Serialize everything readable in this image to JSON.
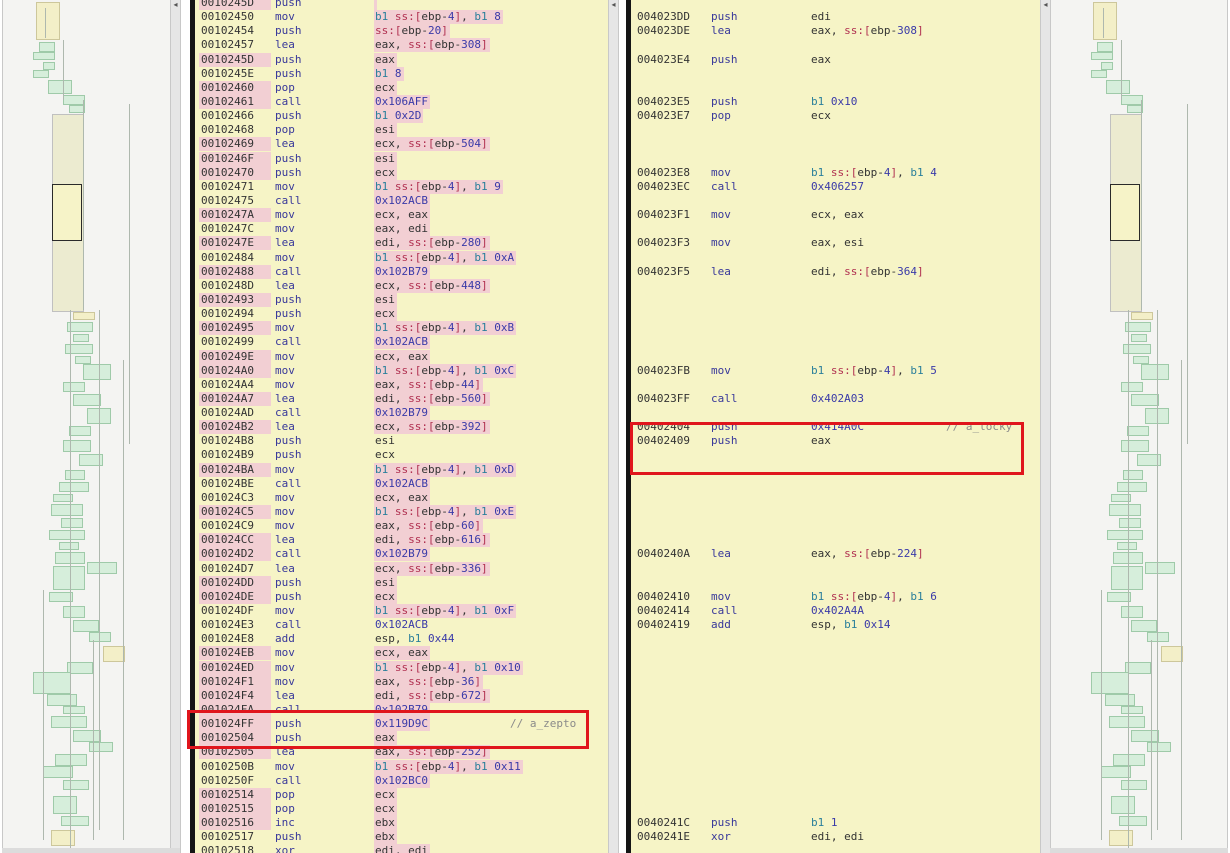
{
  "left_listing": [
    {
      "addr": "0010245D",
      "mnemonic": "push",
      "operand": "",
      "hl_addr": true,
      "hl_op": true
    },
    {
      "addr": "00102450",
      "mnemonic": "mov",
      "operand": "b1 ss:[ebp-4], b1 8",
      "hl_addr": false,
      "hl_op": true
    },
    {
      "addr": "00102454",
      "mnemonic": "push",
      "operand": "ss:[ebp-20]",
      "hl_addr": false,
      "hl_op": true
    },
    {
      "addr": "00102457",
      "mnemonic": "lea",
      "operand": "eax, ss:[ebp-308]",
      "hl_addr": false,
      "hl_op": true
    },
    {
      "addr": "0010245D",
      "mnemonic": "push",
      "operand": "eax",
      "hl_addr": true,
      "hl_op": true
    },
    {
      "addr": "0010245E",
      "mnemonic": "push",
      "operand": "b1 8",
      "hl_addr": false,
      "hl_op": true
    },
    {
      "addr": "00102460",
      "mnemonic": "pop",
      "operand": "ecx",
      "hl_addr": true,
      "hl_op": true
    },
    {
      "addr": "00102461",
      "mnemonic": "call",
      "operand": "0x106AFF",
      "hl_addr": true,
      "hl_op": true
    },
    {
      "addr": "00102466",
      "mnemonic": "push",
      "operand": "b1 0x2D",
      "hl_addr": false,
      "hl_op": true
    },
    {
      "addr": "00102468",
      "mnemonic": "pop",
      "operand": "esi",
      "hl_addr": false,
      "hl_op": true
    },
    {
      "addr": "00102469",
      "mnemonic": "lea",
      "operand": "ecx, ss:[ebp-504]",
      "hl_addr": true,
      "hl_op": true
    },
    {
      "addr": "0010246F",
      "mnemonic": "push",
      "operand": "esi",
      "hl_addr": true,
      "hl_op": true
    },
    {
      "addr": "00102470",
      "mnemonic": "push",
      "operand": "ecx",
      "hl_addr": true,
      "hl_op": true
    },
    {
      "addr": "00102471",
      "mnemonic": "mov",
      "operand": "b1 ss:[ebp-4], b1 9",
      "hl_addr": false,
      "hl_op": true
    },
    {
      "addr": "00102475",
      "mnemonic": "call",
      "operand": "0x102ACB",
      "hl_addr": false,
      "hl_op": true
    },
    {
      "addr": "0010247A",
      "mnemonic": "mov",
      "operand": "ecx, eax",
      "hl_addr": true,
      "hl_op": true
    },
    {
      "addr": "0010247C",
      "mnemonic": "mov",
      "operand": "eax, edi",
      "hl_addr": false,
      "hl_op": true
    },
    {
      "addr": "0010247E",
      "mnemonic": "lea",
      "operand": "edi, ss:[ebp-280]",
      "hl_addr": true,
      "hl_op": true
    },
    {
      "addr": "00102484",
      "mnemonic": "mov",
      "operand": "b1 ss:[ebp-4], b1 0xA",
      "hl_addr": false,
      "hl_op": true
    },
    {
      "addr": "00102488",
      "mnemonic": "call",
      "operand": "0x102B79",
      "hl_addr": true,
      "hl_op": true
    },
    {
      "addr": "0010248D",
      "mnemonic": "lea",
      "operand": "ecx, ss:[ebp-448]",
      "hl_addr": false,
      "hl_op": true
    },
    {
      "addr": "00102493",
      "mnemonic": "push",
      "operand": "esi",
      "hl_addr": true,
      "hl_op": true
    },
    {
      "addr": "00102494",
      "mnemonic": "push",
      "operand": "ecx",
      "hl_addr": false,
      "hl_op": true
    },
    {
      "addr": "00102495",
      "mnemonic": "mov",
      "operand": "b1 ss:[ebp-4], b1 0xB",
      "hl_addr": true,
      "hl_op": true
    },
    {
      "addr": "00102499",
      "mnemonic": "call",
      "operand": "0x102ACB",
      "hl_addr": false,
      "hl_op": true
    },
    {
      "addr": "0010249E",
      "mnemonic": "mov",
      "operand": "ecx, eax",
      "hl_addr": true,
      "hl_op": true
    },
    {
      "addr": "001024A0",
      "mnemonic": "mov",
      "operand": "b1 ss:[ebp-4], b1 0xC",
      "hl_addr": true,
      "hl_op": true
    },
    {
      "addr": "001024A4",
      "mnemonic": "mov",
      "operand": "eax, ss:[ebp-44]",
      "hl_addr": false,
      "hl_op": true
    },
    {
      "addr": "001024A7",
      "mnemonic": "lea",
      "operand": "edi, ss:[ebp-560]",
      "hl_addr": true,
      "hl_op": true
    },
    {
      "addr": "001024AD",
      "mnemonic": "call",
      "operand": "0x102B79",
      "hl_addr": false,
      "hl_op": true
    },
    {
      "addr": "001024B2",
      "mnemonic": "lea",
      "operand": "ecx, ss:[ebp-392]",
      "hl_addr": true,
      "hl_op": true
    },
    {
      "addr": "001024B8",
      "mnemonic": "push",
      "operand": "esi",
      "hl_addr": false,
      "hl_op": false
    },
    {
      "addr": "001024B9",
      "mnemonic": "push",
      "operand": "ecx",
      "hl_addr": false,
      "hl_op": false
    },
    {
      "addr": "001024BA",
      "mnemonic": "mov",
      "operand": "b1 ss:[ebp-4], b1 0xD",
      "hl_addr": true,
      "hl_op": true
    },
    {
      "addr": "001024BE",
      "mnemonic": "call",
      "operand": "0x102ACB",
      "hl_addr": false,
      "hl_op": true
    },
    {
      "addr": "001024C3",
      "mnemonic": "mov",
      "operand": "ecx, eax",
      "hl_addr": false,
      "hl_op": true
    },
    {
      "addr": "001024C5",
      "mnemonic": "mov",
      "operand": "b1 ss:[ebp-4], b1 0xE",
      "hl_addr": true,
      "hl_op": true
    },
    {
      "addr": "001024C9",
      "mnemonic": "mov",
      "operand": "eax, ss:[ebp-60]",
      "hl_addr": false,
      "hl_op": true
    },
    {
      "addr": "001024CC",
      "mnemonic": "lea",
      "operand": "edi, ss:[ebp-616]",
      "hl_addr": true,
      "hl_op": true
    },
    {
      "addr": "001024D2",
      "mnemonic": "call",
      "operand": "0x102B79",
      "hl_addr": true,
      "hl_op": true
    },
    {
      "addr": "001024D7",
      "mnemonic": "lea",
      "operand": "ecx, ss:[ebp-336]",
      "hl_addr": false,
      "hl_op": true
    },
    {
      "addr": "001024DD",
      "mnemonic": "push",
      "operand": "esi",
      "hl_addr": true,
      "hl_op": true
    },
    {
      "addr": "001024DE",
      "mnemonic": "push",
      "operand": "ecx",
      "hl_addr": true,
      "hl_op": true
    },
    {
      "addr": "001024DF",
      "mnemonic": "mov",
      "operand": "b1 ss:[ebp-4], b1 0xF",
      "hl_addr": false,
      "hl_op": true
    },
    {
      "addr": "001024E3",
      "mnemonic": "call",
      "operand": "0x102ACB",
      "hl_addr": false,
      "hl_op": false
    },
    {
      "addr": "001024E8",
      "mnemonic": "add",
      "operand": "esp, b1 0x44",
      "hl_addr": false,
      "hl_op": false
    },
    {
      "addr": "001024EB",
      "mnemonic": "mov",
      "operand": "ecx, eax",
      "hl_addr": true,
      "hl_op": true
    },
    {
      "addr": "001024ED",
      "mnemonic": "mov",
      "operand": "b1 ss:[ebp-4], b1 0x10",
      "hl_addr": true,
      "hl_op": true
    },
    {
      "addr": "001024F1",
      "mnemonic": "mov",
      "operand": "eax, ss:[ebp-36]",
      "hl_addr": true,
      "hl_op": true
    },
    {
      "addr": "001024F4",
      "mnemonic": "lea",
      "operand": "edi, ss:[ebp-672]",
      "hl_addr": true,
      "hl_op": true
    },
    {
      "addr": "001024FA",
      "mnemonic": "call",
      "operand": "0x102B79",
      "hl_addr": true,
      "hl_op": true
    },
    {
      "addr": "001024FF",
      "mnemonic": "push",
      "operand": "0x119D9C",
      "comment": "// a_zepto",
      "hl_addr": true,
      "hl_op": true
    },
    {
      "addr": "00102504",
      "mnemonic": "push",
      "operand": "eax",
      "hl_addr": true,
      "hl_op": true
    },
    {
      "addr": "00102505",
      "mnemonic": "lea",
      "operand": "eax, ss:[ebp-252]",
      "hl_addr": true,
      "hl_op": true
    },
    {
      "addr": "0010250B",
      "mnemonic": "mov",
      "operand": "b1 ss:[ebp-4], b1 0x11",
      "hl_addr": false,
      "hl_op": true
    },
    {
      "addr": "0010250F",
      "mnemonic": "call",
      "operand": "0x102BC0",
      "hl_addr": false,
      "hl_op": true
    },
    {
      "addr": "00102514",
      "mnemonic": "pop",
      "operand": "ecx",
      "hl_addr": true,
      "hl_op": true
    },
    {
      "addr": "00102515",
      "mnemonic": "pop",
      "operand": "ecx",
      "hl_addr": true,
      "hl_op": true
    },
    {
      "addr": "00102516",
      "mnemonic": "inc",
      "operand": "ebx",
      "hl_addr": true,
      "hl_op": true
    },
    {
      "addr": "00102517",
      "mnemonic": "push",
      "operand": "ebx",
      "hl_addr": false,
      "hl_op": true
    },
    {
      "addr": "00102518",
      "mnemonic": "xor",
      "operand": "edi, edi",
      "hl_addr": false,
      "hl_op": true
    }
  ],
  "right_listing": [
    {
      "row": 1,
      "addr": "004023DD",
      "mnemonic": "push",
      "operand": "edi"
    },
    {
      "row": 2,
      "addr": "004023DE",
      "mnemonic": "lea",
      "operand": "eax, ss:[ebp-308]"
    },
    {
      "row": 4,
      "addr": "004023E4",
      "mnemonic": "push",
      "operand": "eax"
    },
    {
      "row": 7,
      "addr": "004023E5",
      "mnemonic": "push",
      "operand": "b1 0x10"
    },
    {
      "row": 8,
      "addr": "004023E7",
      "mnemonic": "pop",
      "operand": "ecx"
    },
    {
      "row": 12,
      "addr": "004023E8",
      "mnemonic": "mov",
      "operand": "b1 ss:[ebp-4], b1 4"
    },
    {
      "row": 13,
      "addr": "004023EC",
      "mnemonic": "call",
      "operand": "0x406257"
    },
    {
      "row": 15,
      "addr": "004023F1",
      "mnemonic": "mov",
      "operand": "ecx, eax"
    },
    {
      "row": 17,
      "addr": "004023F3",
      "mnemonic": "mov",
      "operand": "eax, esi"
    },
    {
      "row": 19,
      "addr": "004023F5",
      "mnemonic": "lea",
      "operand": "edi, ss:[ebp-364]"
    },
    {
      "row": 26,
      "addr": "004023FB",
      "mnemonic": "mov",
      "operand": "b1 ss:[ebp-4], b1 5"
    },
    {
      "row": 28,
      "addr": "004023FF",
      "mnemonic": "call",
      "operand": "0x402A03"
    },
    {
      "row": 30,
      "addr": "00402404",
      "mnemonic": "push",
      "operand": "0x414A0C",
      "comment": "// a_locky"
    },
    {
      "row": 31,
      "addr": "00402409",
      "mnemonic": "push",
      "operand": "eax"
    },
    {
      "row": 39,
      "addr": "0040240A",
      "mnemonic": "lea",
      "operand": "eax, ss:[ebp-224]"
    },
    {
      "row": 42,
      "addr": "00402410",
      "mnemonic": "mov",
      "operand": "b1 ss:[ebp-4], b1 6"
    },
    {
      "row": 43,
      "addr": "00402414",
      "mnemonic": "call",
      "operand": "0x402A4A"
    },
    {
      "row": 44,
      "addr": "00402419",
      "mnemonic": "add",
      "operand": "esp, b1 0x14"
    },
    {
      "row": 58,
      "addr": "0040241C",
      "mnemonic": "push",
      "operand": "b1 1"
    },
    {
      "row": 59,
      "addr": "0040241E",
      "mnemonic": "xor",
      "operand": "edi, edi"
    }
  ],
  "colors": {
    "pane_background": "#f6f4c6",
    "unmatched_highlight": "#f2cfd3",
    "annotation_box": "#e0151c",
    "overview_block": "#d6eedb"
  }
}
